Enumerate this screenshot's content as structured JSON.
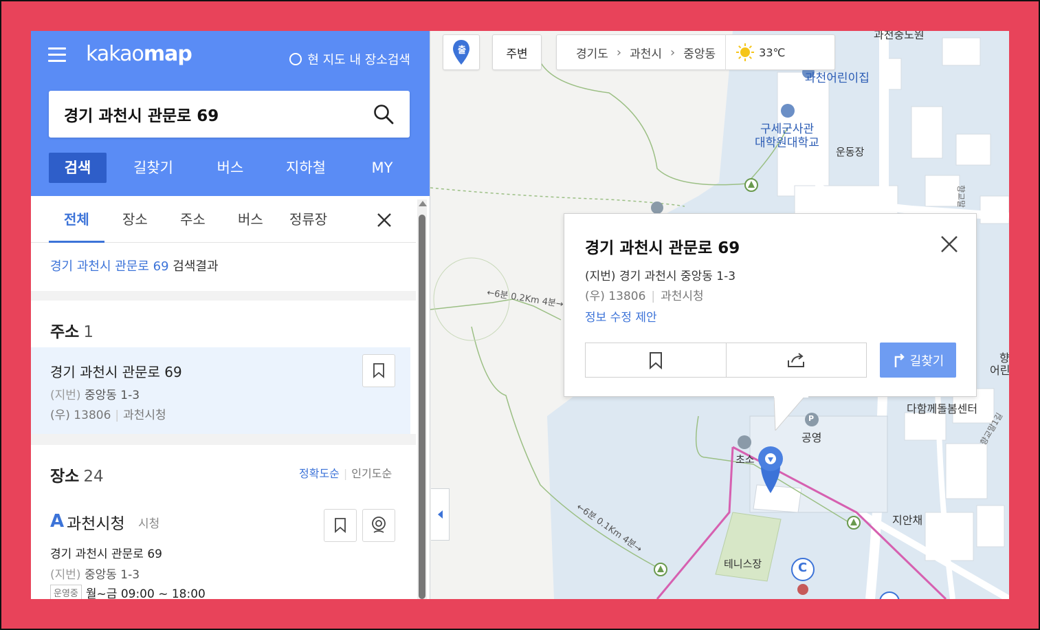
{
  "app": {
    "logo_light": "kakao",
    "logo_bold": "map",
    "area_search_label": "현 지도 내 장소검색"
  },
  "search": {
    "value": "경기 과천시 관문로 69",
    "placeholder": ""
  },
  "main_tabs": [
    "검색",
    "길찾기",
    "버스",
    "지하철",
    "MY"
  ],
  "sub_tabs": [
    "전체",
    "장소",
    "주소",
    "버스",
    "정류장"
  ],
  "results": {
    "keyword": "경기 과천시 관문로 69",
    "suffix": " 검색결과"
  },
  "address_section": {
    "title": "주소",
    "count": "1",
    "item": {
      "road": "경기 과천시 관문로 69",
      "jibun_label": "(지번)",
      "jibun": " 중앙동 1-3",
      "zip_label": "(우) 13806",
      "place": "과천시청"
    }
  },
  "place_section": {
    "title": "장소",
    "count": "24",
    "sort_accuracy": "정확도순",
    "sort_popular": "인기도순",
    "item": {
      "letter": "A",
      "name": "과천시청",
      "category": "시청",
      "address": "경기 과천시 관문로 69",
      "jibun_label": "(지번)",
      "jibun": " 중앙동 1-3",
      "open_badge": "운영중",
      "hours": "월~금 09:00 ~ 18:00"
    }
  },
  "map_toolbar": {
    "start_pin": "출",
    "nearby": "주변",
    "breadcrumb": [
      "경기도",
      "과천시",
      "중앙동"
    ],
    "temperature": "33℃"
  },
  "popup": {
    "title": "경기 과천시 관문로 69",
    "jibun": "(지번) 경기 과천시 중앙동 1-3",
    "zip": "(우) 13806",
    "place": "과천시청",
    "edit_link": "정보 수정 제안",
    "route_label": "길찾기"
  },
  "map_labels": {
    "top_cut": "과천중도원",
    "kindergarten": "과천어린이집",
    "academy_1": "구세군사관",
    "academy_2": "대학원대학교",
    "playground": "운동장",
    "trail_1": "←6분 0.2Km 4분→",
    "trail_2": "←6분 0.1Km 4분→",
    "daham": "다함께돌봄센터",
    "public_parking": "공영",
    "parking_p": "P",
    "jian": "지안채",
    "tennis": "테니스장",
    "cho": "초소",
    "street_1": "향교말",
    "street_2": "향교말1길",
    "right_cut_1": "향",
    "right_cut_2": "어린",
    "marker_c": "C"
  },
  "colors": {
    "brand_blue": "#5a8cf5",
    "active_tab": "#2e5ec9",
    "link_blue": "#3c73d8",
    "route_btn": "#6e9cf2",
    "boundary_pink": "#d660b0",
    "frame_red": "#e8435a"
  }
}
